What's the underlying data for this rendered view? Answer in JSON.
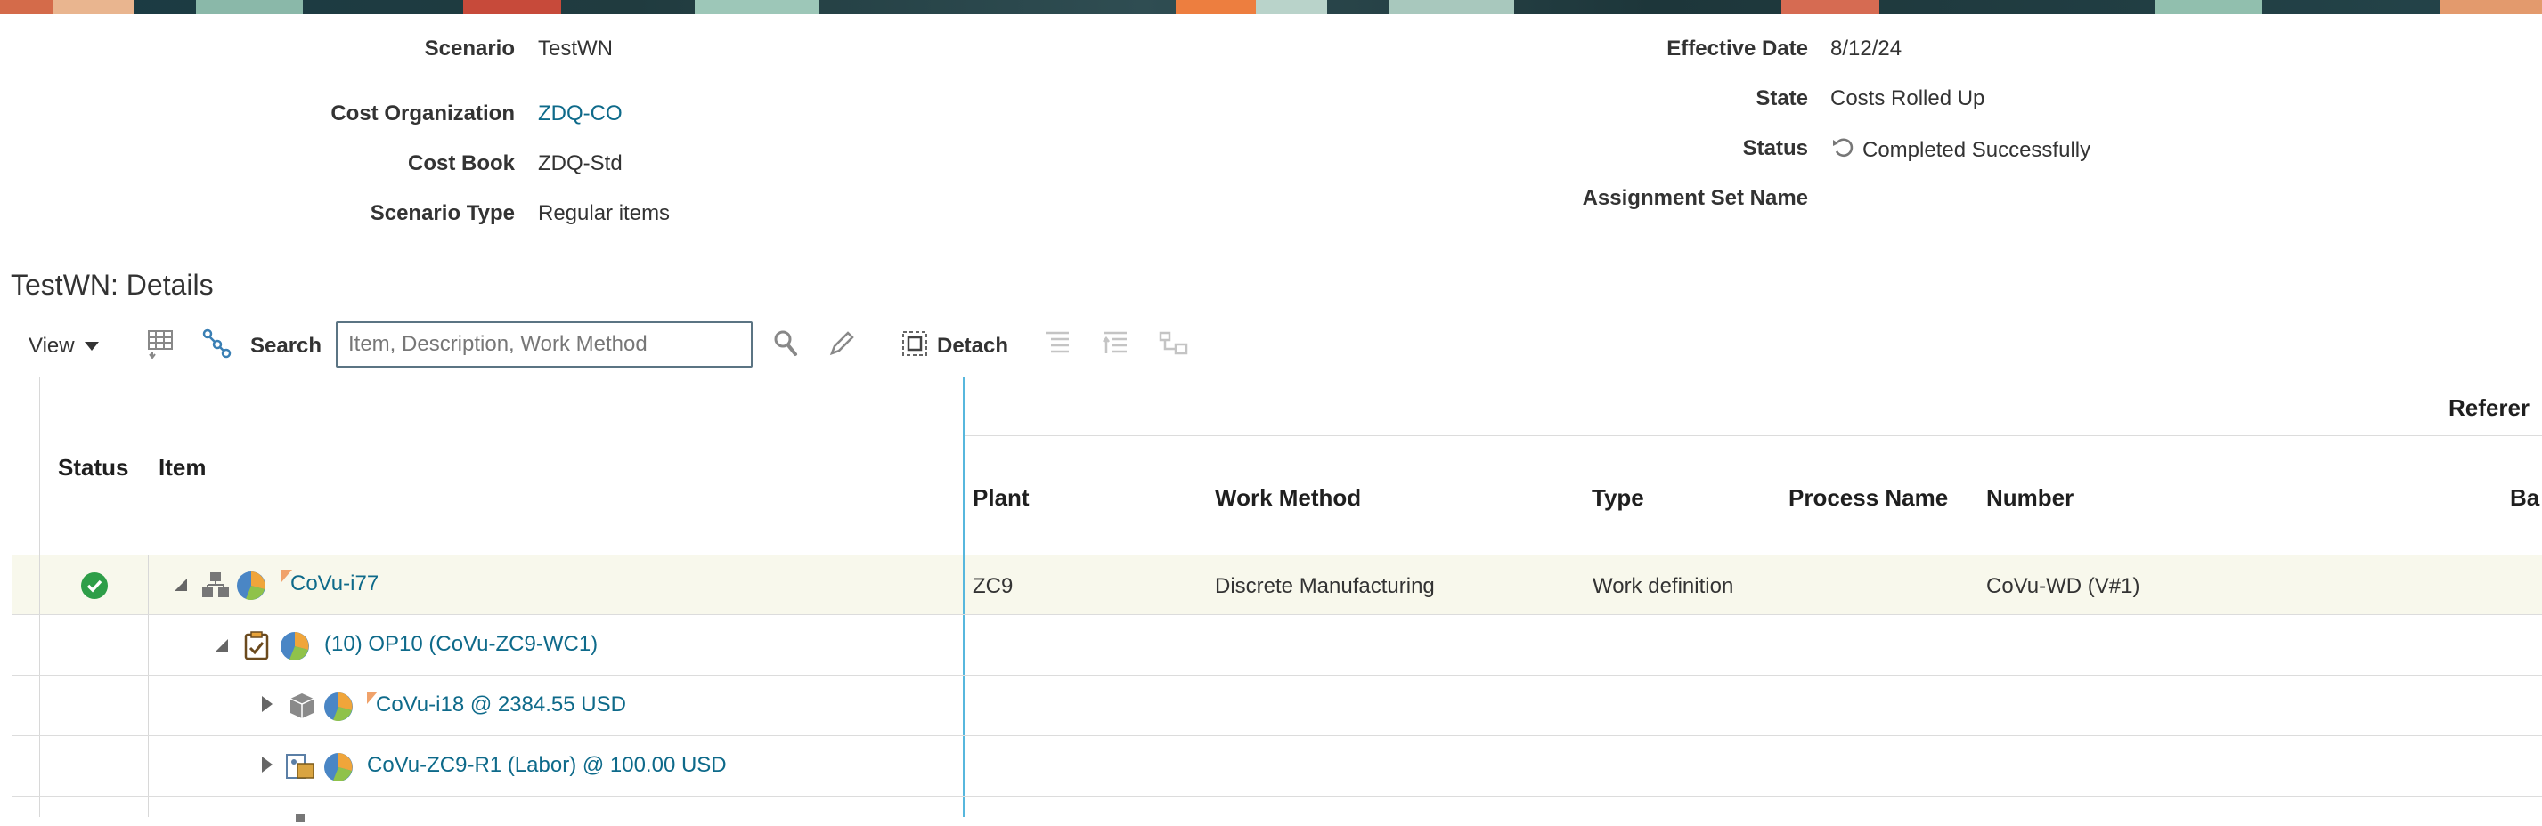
{
  "header": {
    "scenario_label": "Scenario",
    "scenario_value": "TestWN",
    "cost_org_label": "Cost Organization",
    "cost_org_value": "ZDQ-CO",
    "cost_book_label": "Cost Book",
    "cost_book_value": "ZDQ-Std",
    "scenario_type_label": "Scenario Type",
    "scenario_type_value": "Regular items",
    "effective_date_label": "Effective Date",
    "effective_date_value": "8/12/24",
    "state_label": "State",
    "state_value": "Costs Rolled Up",
    "status_label": "Status",
    "status_value": "Completed Successfully",
    "assignment_set_label": "Assignment Set Name"
  },
  "details": {
    "title": "TestWN: Details"
  },
  "toolbar": {
    "view_label": "View",
    "search_label": "Search",
    "search_placeholder": "Item, Description, Work Method",
    "detach_label": "Detach"
  },
  "grid": {
    "group_header": "Referer",
    "columns": {
      "status": "Status",
      "item": "Item",
      "plant": "Plant",
      "work_method": "Work Method",
      "type": "Type",
      "process_name": "Process Name",
      "number": "Number",
      "ba": "Ba"
    },
    "rows": [
      {
        "item": "CoVu-i77",
        "plant": "ZC9",
        "work_method": "Discrete Manufacturing",
        "type": "Work definition",
        "number": "CoVu-WD (V#1)"
      },
      {
        "item": "(10) OP10 (CoVu-ZC9-WC1)"
      },
      {
        "item": "CoVu-i18 @ 2384.55 USD"
      },
      {
        "item": "CoVu-ZC9-R1 (Labor) @ 100.00 USD"
      }
    ]
  },
  "colors": {
    "link": "#0e6a8a",
    "freeze_line": "#57b7dd",
    "success": "#2e9e48",
    "selected_row": "#f8f8ec"
  },
  "icons": [
    "refresh-icon",
    "caret-down-icon",
    "freeze-columns-icon",
    "hierarchy-icon",
    "search-icon",
    "edit-icon",
    "detach-icon",
    "expand-icon",
    "collapse-icon",
    "scope-icon",
    "success-check-icon",
    "structure-icon",
    "pie-icon",
    "flag-icon",
    "operation-icon",
    "component-icon",
    "resource-icon"
  ]
}
